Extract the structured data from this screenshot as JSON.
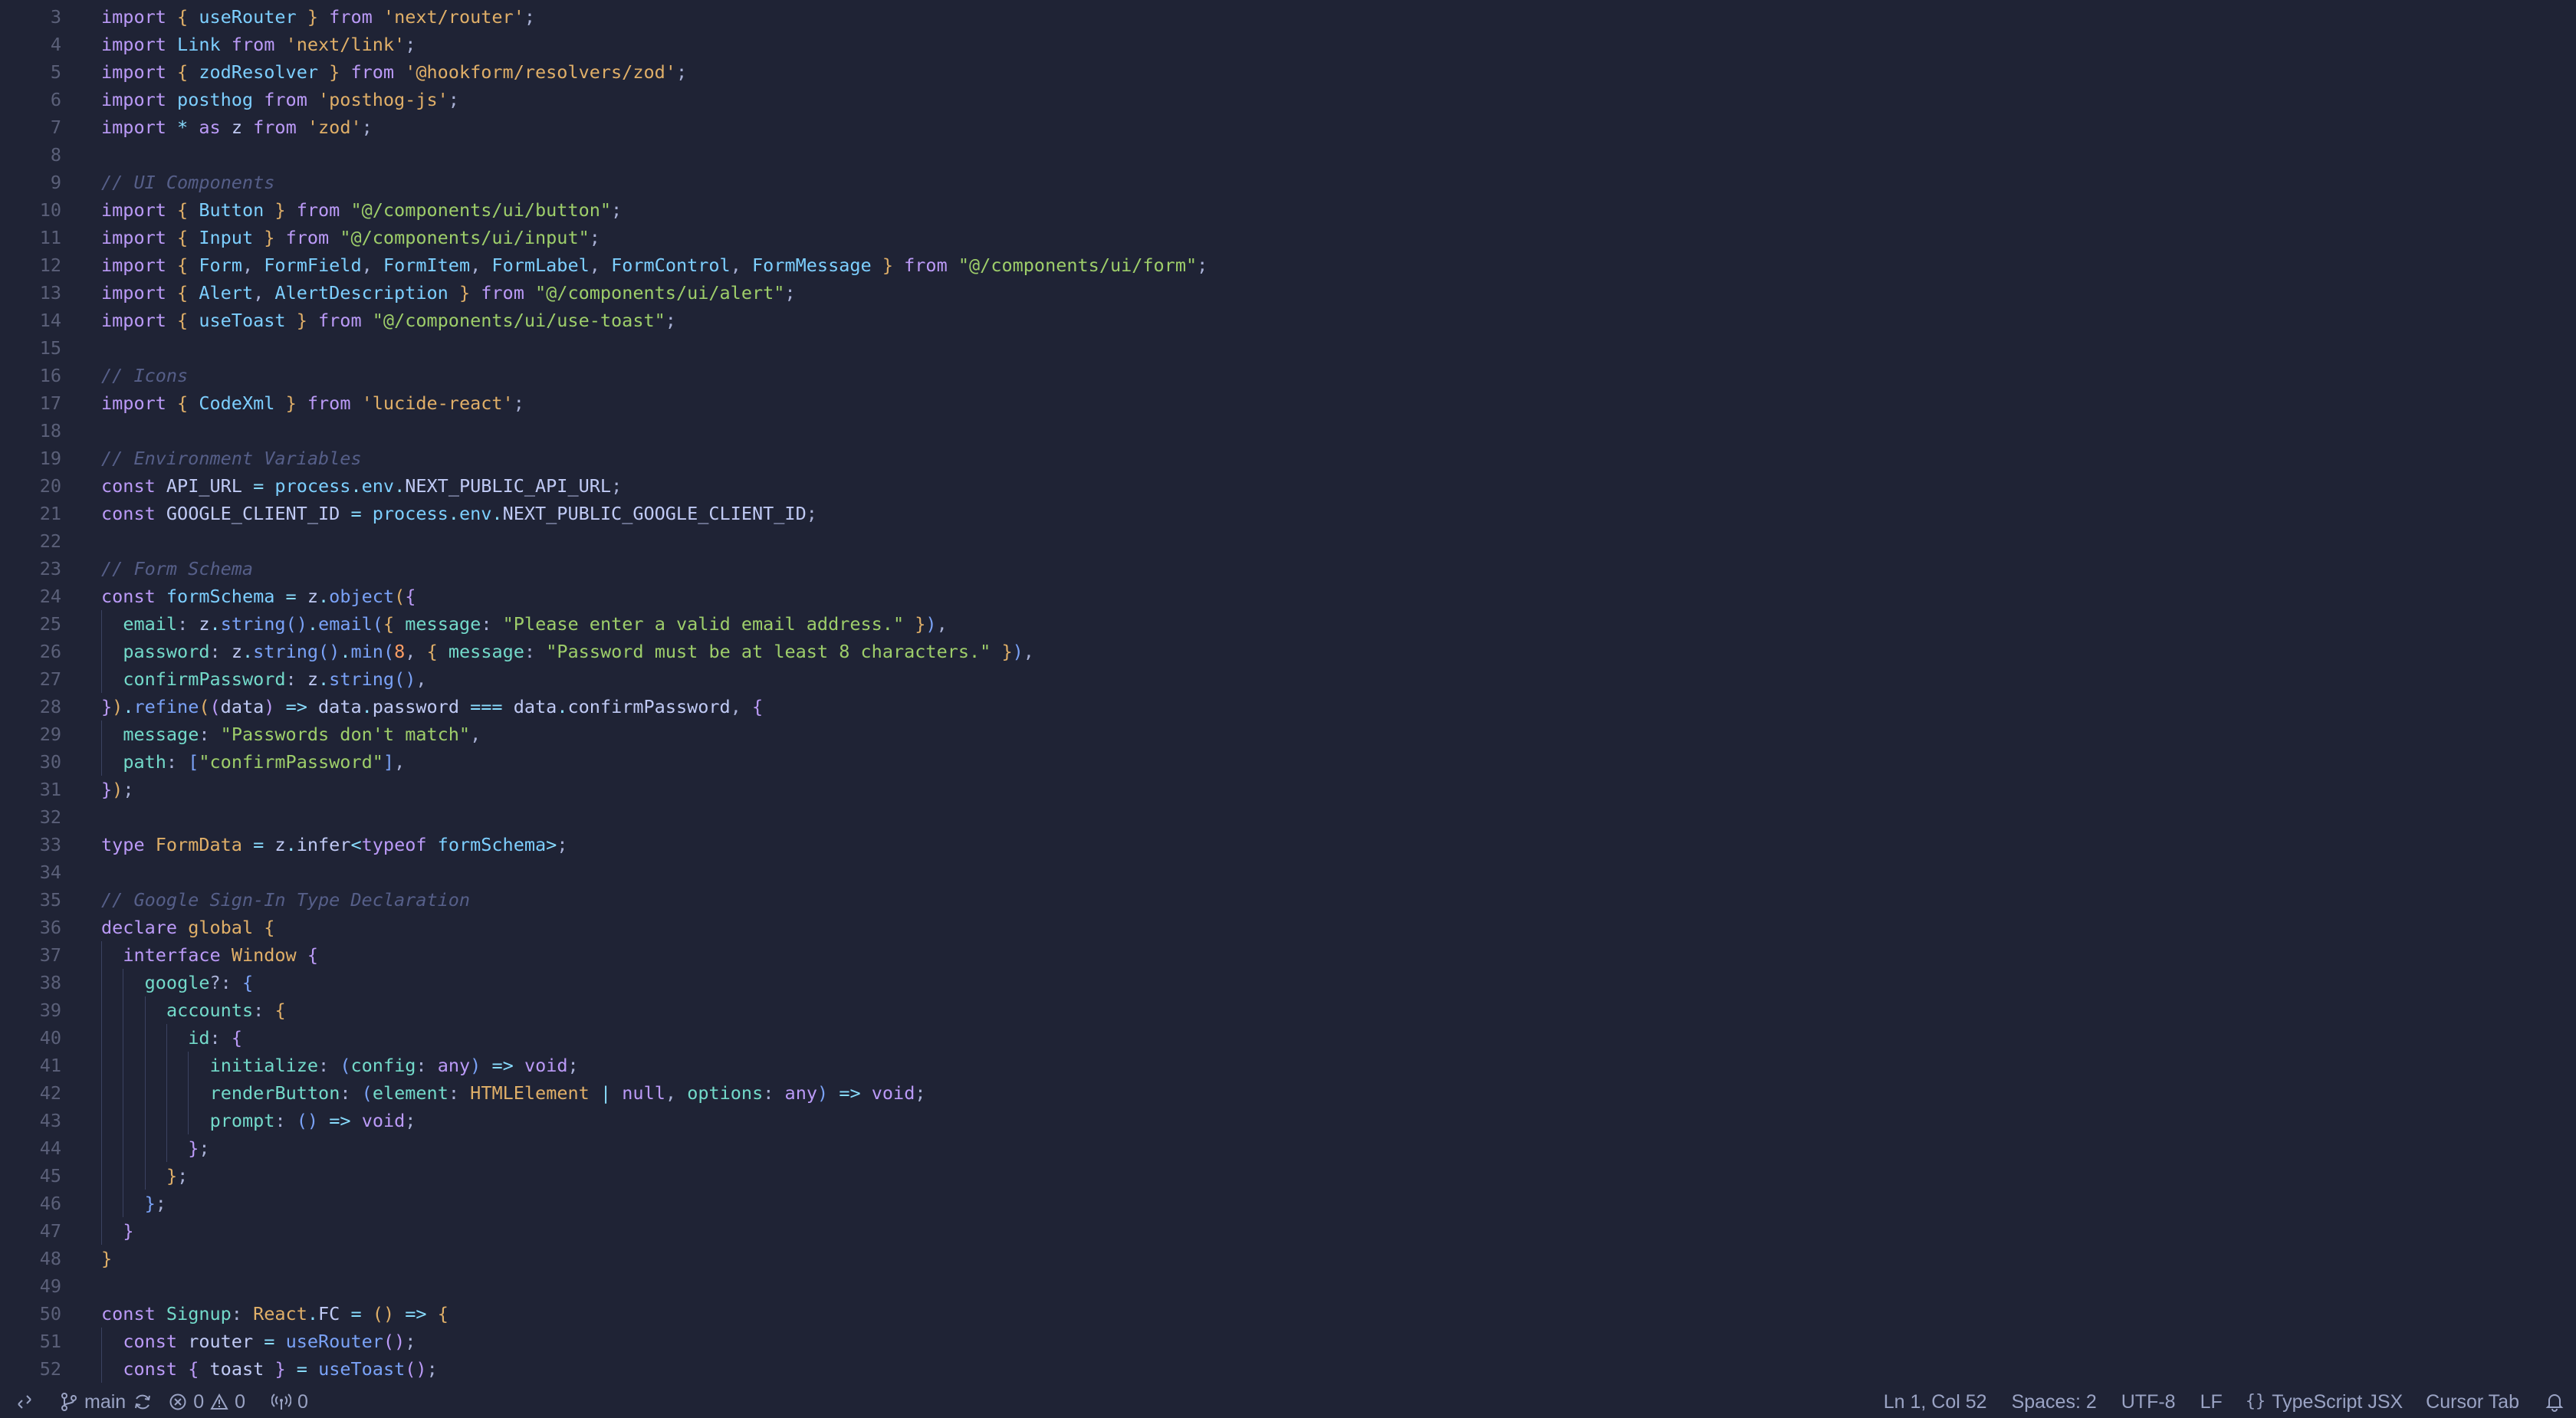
{
  "editor": {
    "language_colors": {
      "keyword": "#bb9af7",
      "identifier": "#c0caf5",
      "import_name": "#7dcfff",
      "string": "#9ece6a",
      "string_module": "#e0af68",
      "comment": "#565f89",
      "type": "#e0af68",
      "function": "#7aa2f7",
      "property": "#73daca",
      "constant": "#c0caf5",
      "operator": "#89ddff",
      "bracket_1": "#e0af68",
      "bracket_2": "#bb9af7",
      "bracket_3": "#7aa2f7"
    },
    "lines": [
      {
        "num": "3",
        "text": "import { useRouter } from 'next/router';"
      },
      {
        "num": "4",
        "text": "import Link from 'next/link';"
      },
      {
        "num": "5",
        "text": "import { zodResolver } from '@hookform/resolvers/zod';"
      },
      {
        "num": "6",
        "text": "import posthog from 'posthog-js';"
      },
      {
        "num": "7",
        "text": "import * as z from 'zod';"
      },
      {
        "num": "8",
        "text": ""
      },
      {
        "num": "9",
        "text": "// UI Components"
      },
      {
        "num": "10",
        "text": "import { Button } from \"@/components/ui/button\";"
      },
      {
        "num": "11",
        "text": "import { Input } from \"@/components/ui/input\";"
      },
      {
        "num": "12",
        "text": "import { Form, FormField, FormItem, FormLabel, FormControl, FormMessage } from \"@/components/ui/form\";"
      },
      {
        "num": "13",
        "text": "import { Alert, AlertDescription } from \"@/components/ui/alert\";"
      },
      {
        "num": "14",
        "text": "import { useToast } from \"@/components/ui/use-toast\";"
      },
      {
        "num": "15",
        "text": ""
      },
      {
        "num": "16",
        "text": "// Icons"
      },
      {
        "num": "17",
        "text": "import { CodeXml } from 'lucide-react';"
      },
      {
        "num": "18",
        "text": ""
      },
      {
        "num": "19",
        "text": "// Environment Variables"
      },
      {
        "num": "20",
        "text": "const API_URL = process.env.NEXT_PUBLIC_API_URL;"
      },
      {
        "num": "21",
        "text": "const GOOGLE_CLIENT_ID = process.env.NEXT_PUBLIC_GOOGLE_CLIENT_ID;"
      },
      {
        "num": "22",
        "text": ""
      },
      {
        "num": "23",
        "text": "// Form Schema"
      },
      {
        "num": "24",
        "text": "const formSchema = z.object({"
      },
      {
        "num": "25",
        "text": "  email: z.string().email({ message: \"Please enter a valid email address.\" }),"
      },
      {
        "num": "26",
        "text": "  password: z.string().min(8, { message: \"Password must be at least 8 characters.\" }),"
      },
      {
        "num": "27",
        "text": "  confirmPassword: z.string(),"
      },
      {
        "num": "28",
        "text": "}).refine((data) => data.password === data.confirmPassword, {"
      },
      {
        "num": "29",
        "text": "  message: \"Passwords don't match\","
      },
      {
        "num": "30",
        "text": "  path: [\"confirmPassword\"],"
      },
      {
        "num": "31",
        "text": "});"
      },
      {
        "num": "32",
        "text": ""
      },
      {
        "num": "33",
        "text": "type FormData = z.infer<typeof formSchema>;"
      },
      {
        "num": "34",
        "text": ""
      },
      {
        "num": "35",
        "text": "// Google Sign-In Type Declaration"
      },
      {
        "num": "36",
        "text": "declare global {"
      },
      {
        "num": "37",
        "text": "  interface Window {"
      },
      {
        "num": "38",
        "text": "    google?: {"
      },
      {
        "num": "39",
        "text": "      accounts: {"
      },
      {
        "num": "40",
        "text": "        id: {"
      },
      {
        "num": "41",
        "text": "          initialize: (config: any) => void;"
      },
      {
        "num": "42",
        "text": "          renderButton: (element: HTMLElement | null, options: any) => void;"
      },
      {
        "num": "43",
        "text": "          prompt: () => void;"
      },
      {
        "num": "44",
        "text": "        };"
      },
      {
        "num": "45",
        "text": "      };"
      },
      {
        "num": "46",
        "text": "    };"
      },
      {
        "num": "47",
        "text": "  }"
      },
      {
        "num": "48",
        "text": "}"
      },
      {
        "num": "49",
        "text": ""
      },
      {
        "num": "50",
        "text": "const Signup: React.FC = () => {"
      },
      {
        "num": "51",
        "text": "  const router = useRouter();"
      },
      {
        "num": "52",
        "text": "  const { toast } = useToast();"
      }
    ]
  },
  "statusbar": {
    "remote_icon": "remote-icon",
    "branch": "main",
    "branch_icon": "git-branch-icon",
    "sync_icon": "sync-icon",
    "errors": "0",
    "warnings": "0",
    "ports": "0",
    "cursor_position": "Ln 1, Col 52",
    "indentation": "Spaces: 2",
    "encoding": "UTF-8",
    "eol": "LF",
    "language_icon": "braces-icon",
    "language": "TypeScript JSX",
    "tab_mode": "Cursor Tab",
    "notification_icon": "bell-icon"
  }
}
